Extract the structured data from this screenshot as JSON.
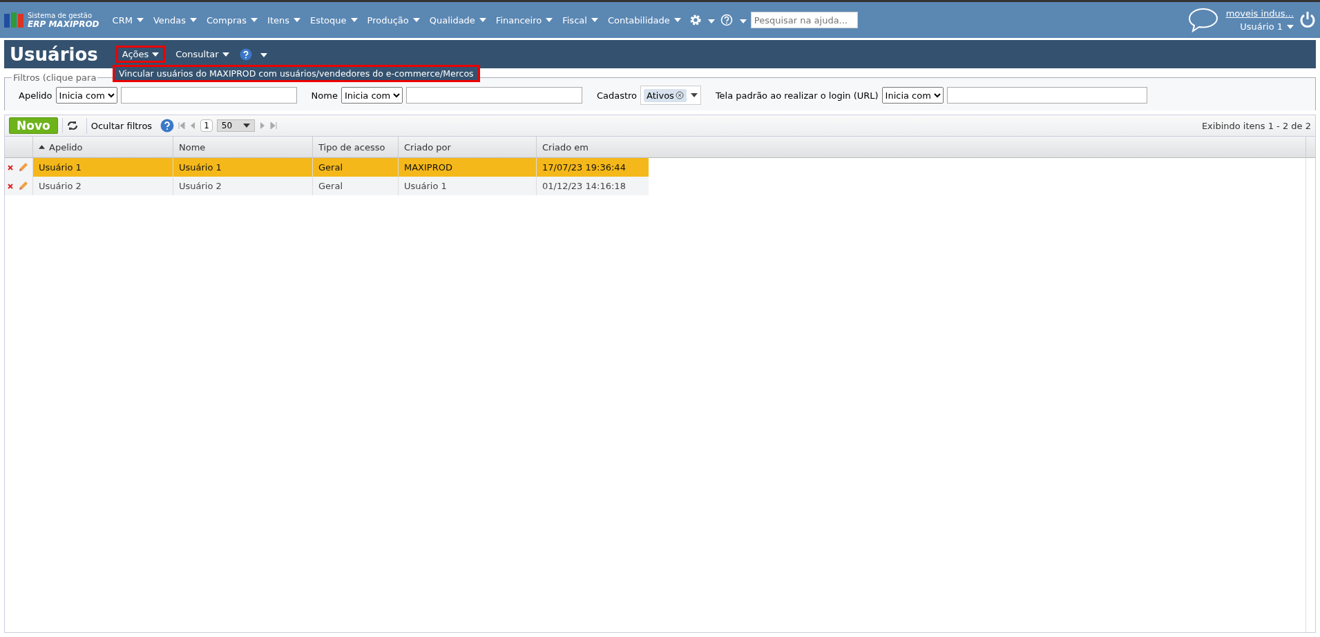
{
  "brand": {
    "line1": "Sistema de gestão",
    "line2": "ERP MAXIPROD"
  },
  "nav": [
    {
      "label": "CRM"
    },
    {
      "label": "Vendas"
    },
    {
      "label": "Compras"
    },
    {
      "label": "Itens"
    },
    {
      "label": "Estoque"
    },
    {
      "label": "Produção"
    },
    {
      "label": "Qualidade"
    },
    {
      "label": "Financeiro"
    },
    {
      "label": "Fiscal"
    },
    {
      "label": "Contabilidade"
    }
  ],
  "help_search": {
    "placeholder": "Pesquisar na ajuda..."
  },
  "account": {
    "company": "moveis indus...",
    "user": "Usuário 1"
  },
  "page": {
    "title": "Usuários",
    "menus": [
      {
        "label": "Ações",
        "selected": true
      },
      {
        "label": "Consultar",
        "selected": false
      }
    ]
  },
  "dropdown": {
    "items": [
      "Vincular usuários do MAXIPROD com usuários/vendedores do e-commerce/Mercos"
    ]
  },
  "filters": {
    "legend": "Filtros (clique para",
    "fields": [
      {
        "label": "Apelido",
        "mode": "Inicia com"
      },
      {
        "label": "Nome",
        "mode": "Inicia com"
      },
      {
        "label": "Cadastro",
        "tag": "Ativos"
      },
      {
        "label": "Tela padrão ao realizar o login (URL)",
        "mode": "Inicia com"
      }
    ]
  },
  "toolbar": {
    "new": "Novo",
    "hide_filters": "Ocultar filtros",
    "page": "1",
    "page_size": "50",
    "summary": "Exibindo itens 1 - 2 de 2"
  },
  "table": {
    "columns": [
      "Apelido",
      "Nome",
      "Tipo de acesso",
      "Criado por",
      "Criado em"
    ],
    "rows": [
      {
        "selected": true,
        "cells": [
          "Usuário 1",
          "Usuário 1",
          "Geral",
          "MAXIPROD",
          "17/07/23 19:36:44"
        ]
      },
      {
        "selected": false,
        "cells": [
          "Usuário 2",
          "Usuário 2",
          "Geral",
          "Usuário 1",
          "01/12/23 14:16:18"
        ]
      }
    ]
  }
}
